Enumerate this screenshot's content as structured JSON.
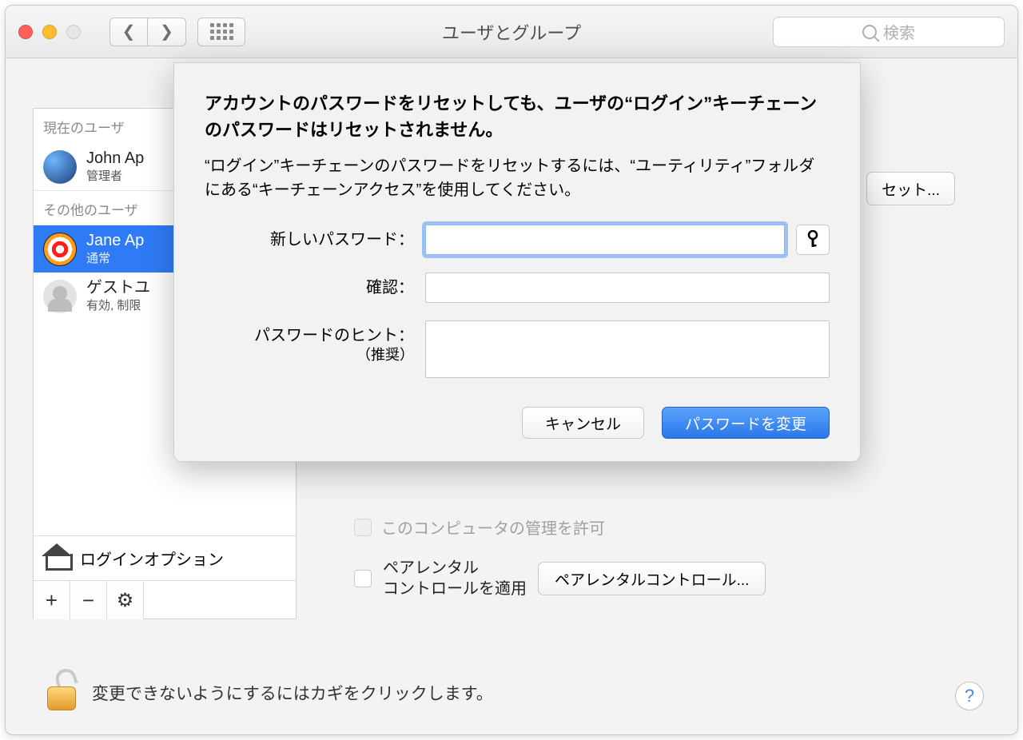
{
  "window": {
    "title": "ユーザとグループ",
    "search_placeholder": "検索"
  },
  "sidebar": {
    "current_user_header": "現在のユーザ",
    "other_users_header": "その他のユーザ",
    "login_options_label": "ログインオプション",
    "users": [
      {
        "name": "John Ap",
        "role": "管理者"
      },
      {
        "name": "Jane Ap",
        "role": "通常"
      },
      {
        "name": "ゲストユ",
        "role": "有効, 制限"
      }
    ]
  },
  "right_panel": {
    "reset_button": "セット...",
    "allow_admin_label": "このコンピュータの管理を許可",
    "parental_label_line1": "ペアレンタル",
    "parental_label_line2": "コントロールを適用",
    "parental_button": "ペアレンタルコントロール..."
  },
  "lock": {
    "text": "変更できないようにするにはカギをクリックします。"
  },
  "dialog": {
    "heading": "アカウントのパスワードをリセットしても、ユーザの“ログイン”キーチェーンのパスワードはリセットされません。",
    "description": "“ログイン”キーチェーンのパスワードをリセットするには、“ユーティリティ”フォルダにある“キーチェーンアクセス”を使用してください。",
    "new_password_label": "新しいパスワード：",
    "confirm_label": "確認：",
    "hint_label": "パスワードのヒント：",
    "hint_sub": "（推奨）",
    "cancel": "キャンセル",
    "submit": "パスワードを変更"
  },
  "help_glyph": "?"
}
